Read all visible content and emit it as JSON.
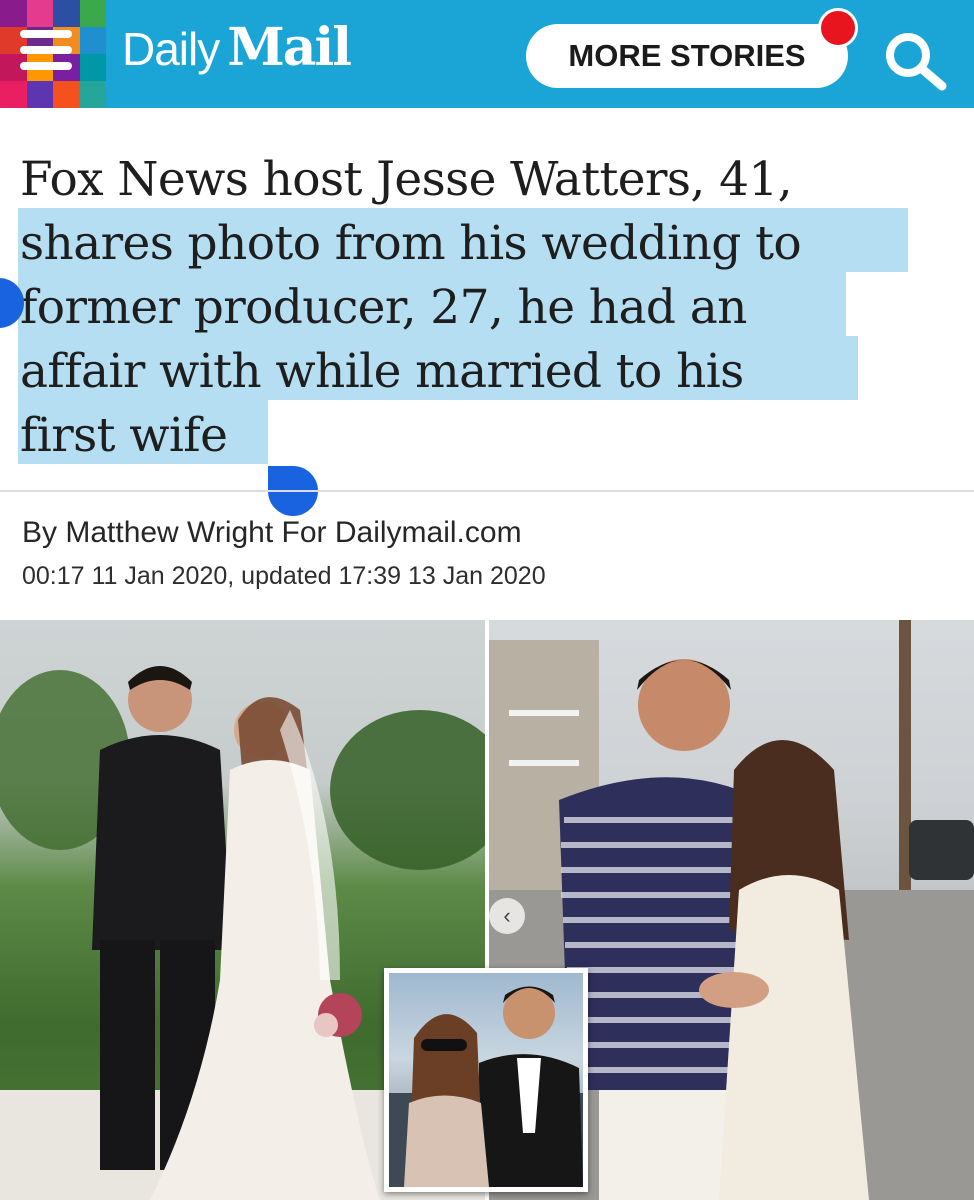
{
  "header": {
    "logo_daily": "Daily",
    "logo_mail": "Mail",
    "more_stories_label": "MORE STORIES",
    "brand_color": "#1aa5d6",
    "notification_color": "#e8151f",
    "mosaic_colors": [
      "#8a1b8d",
      "#e43b8e",
      "#2b4fa3",
      "#3aa84b",
      "#e03a2a",
      "#6d2a8a",
      "#f28c1f",
      "#1f8fd0",
      "#c2185b",
      "#ff9800",
      "#7b1fa2",
      "#0097a7",
      "#e91e63",
      "#5e35b1",
      "#f4511e",
      "#26a69a"
    ]
  },
  "article": {
    "headline_line1": "Fox News host Jesse Watters, 41,",
    "headline_line2": "shares photo from his wedding to",
    "headline_line3": "former producer, 27, he had an",
    "headline_line4": "affair with while married to his",
    "headline_line5": "first wife",
    "byline": "By Matthew Wright For Dailymail.com",
    "dateline": "00:17 11 Jan 2020, updated 17:39 13 Jan 2020",
    "selection_color": "#b6def2",
    "selection_handle_color": "#1a63e0"
  },
  "photos": {
    "left": "wedding-photo",
    "right": "couple-photo",
    "inset": "inset-photo",
    "carousel_arrow": "‹"
  }
}
